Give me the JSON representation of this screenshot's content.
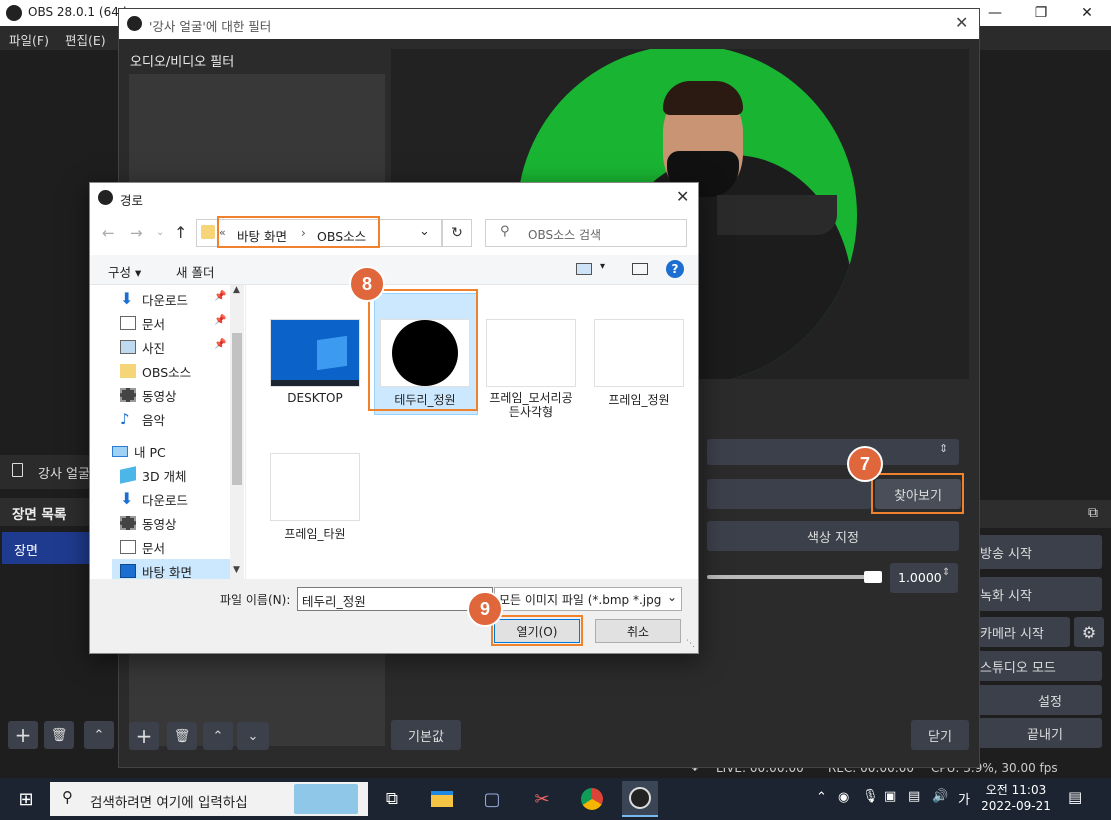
{
  "obs": {
    "title": "OBS 28.0.1 (64-b",
    "menu": [
      "파일(F)",
      "편집(E)"
    ],
    "source_label": "강사 얼굴",
    "scenes_header": "장면 목록",
    "scene_item": "장면",
    "controls": [
      "방송 시작",
      "녹화 시작",
      "카메라 시작",
      "스튜디오 모드",
      "설정",
      "끝내기"
    ],
    "status": {
      "live": "LIVE: 00:00:00",
      "rec": "REC: 00:00:00",
      "cpu": "CPU: 3.9%, 30.00 fps"
    }
  },
  "filter_dialog": {
    "title": "'강사 얼굴'에 대한 필터",
    "section_label": "오디오/비디오 필터",
    "browse_button": "찾아보기",
    "color_button": "색상 지정",
    "opacity_value": "1.0000",
    "defaults_button": "기본값",
    "close_button": "닫기"
  },
  "file_dialog": {
    "title": "경로",
    "breadcrumb": [
      "바탕 화면",
      "OBS소스"
    ],
    "search_placeholder": "OBS소스 검색",
    "organize": "구성",
    "new_folder": "새 폴더",
    "tree": [
      {
        "label": "다운로드",
        "pinned": true,
        "icon": "download-icon"
      },
      {
        "label": "문서",
        "pinned": true,
        "icon": "document-icon"
      },
      {
        "label": "사진",
        "pinned": true,
        "icon": "picture-icon"
      },
      {
        "label": "OBS소스",
        "pinned": false,
        "icon": "folder-icon"
      },
      {
        "label": "동영상",
        "pinned": false,
        "icon": "video-icon"
      },
      {
        "label": "음악",
        "pinned": false,
        "icon": "music-icon"
      },
      {
        "label": "내 PC",
        "pinned": false,
        "icon": "pc-icon"
      },
      {
        "label": "3D 개체",
        "pinned": false,
        "icon": "cube-icon"
      },
      {
        "label": "다운로드",
        "pinned": false,
        "icon": "download-icon"
      },
      {
        "label": "동영상",
        "pinned": false,
        "icon": "video-icon"
      },
      {
        "label": "문서",
        "pinned": false,
        "icon": "document-icon"
      },
      {
        "label": "바탕 화면",
        "pinned": false,
        "icon": "desktop-icon"
      }
    ],
    "files": [
      {
        "name": "DESKTOP"
      },
      {
        "name": "테두리_정원"
      },
      {
        "name": "프레임_모서리공\n든사각형"
      },
      {
        "name": "프레임_정원"
      },
      {
        "name": "프레임_타원"
      }
    ],
    "filename_label": "파일 이름(N):",
    "filename_value": "테두리_정원",
    "filter_value": "모든 이미지 파일 (*.bmp *.jpg",
    "open_button": "열기(O)",
    "cancel_button": "취소"
  },
  "badges": [
    "7",
    "8",
    "9"
  ],
  "taskbar": {
    "search_placeholder": "검색하려면 여기에 입력하십",
    "ime": "가",
    "time": "오전 11:03",
    "date": "2022-09-21"
  },
  "colors": {
    "accent": "#f0822d",
    "badge": "#e0663b",
    "selection": "#cce8ff",
    "green": "#19b532"
  }
}
